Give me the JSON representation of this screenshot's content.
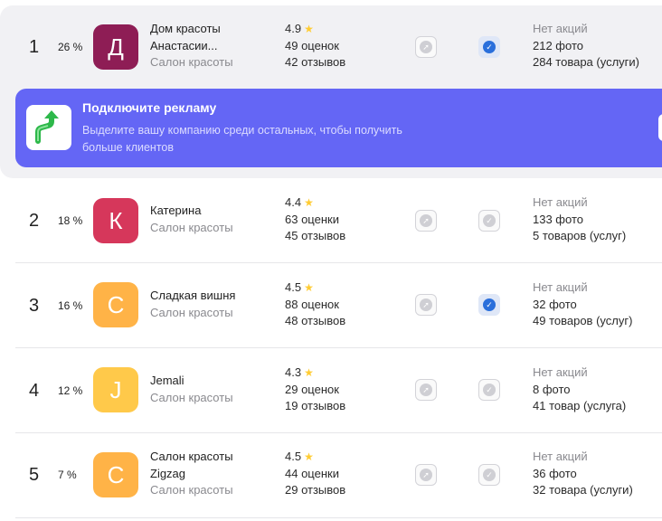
{
  "rows": [
    {
      "rank": "1",
      "share": "26 %",
      "avatar_letter": "Д",
      "avatar_color": "#8e1d55",
      "name_line1": "Дом красоты",
      "name_line2": "Анастасии...",
      "subtype": "Салон красоты",
      "rating": "4.9",
      "ratings_count": "49 оценок",
      "reviews_count": "42 отзывов",
      "verified": true,
      "promos": "Нет акций",
      "photos": "212 фото",
      "goods": "284 товара (услуги)"
    },
    {
      "rank": "2",
      "share": "18 %",
      "avatar_letter": "К",
      "avatar_color": "#d6375b",
      "name_line1": "Катерина",
      "name_line2": "",
      "subtype": "Салон красоты",
      "rating": "4.4",
      "ratings_count": "63 оценки",
      "reviews_count": "45 отзывов",
      "verified": false,
      "promos": "Нет акций",
      "photos": "133 фото",
      "goods": "5 товаров (услуг)"
    },
    {
      "rank": "3",
      "share": "16 %",
      "avatar_letter": "С",
      "avatar_color": "#ffb347",
      "name_line1": "Сладкая вишня",
      "name_line2": "",
      "subtype": "Салон красоты",
      "rating": "4.5",
      "ratings_count": "88 оценок",
      "reviews_count": "48 отзывов",
      "verified": true,
      "promos": "Нет акций",
      "photos": "32 фото",
      "goods": "49 товаров (услуг)"
    },
    {
      "rank": "4",
      "share": "12 %",
      "avatar_letter": "J",
      "avatar_color": "#ffc94a",
      "name_line1": "Jemali",
      "name_line2": "",
      "subtype": "Салон красоты",
      "rating": "4.3",
      "ratings_count": "29 оценок",
      "reviews_count": "19 отзывов",
      "verified": false,
      "promos": "Нет акций",
      "photos": "8 фото",
      "goods": "41 товар (услуга)"
    },
    {
      "rank": "5",
      "share": "7 %",
      "avatar_letter": "С",
      "avatar_color": "#ffb347",
      "name_line1": "Салон красоты",
      "name_line2": "Zigzag",
      "subtype": "Салон красоты",
      "rating": "4.5",
      "ratings_count": "44 оценки",
      "reviews_count": "29 отзывов",
      "verified": false,
      "promos": "Нет акций",
      "photos": "36 фото",
      "goods": "32 товара (услуги)"
    }
  ],
  "ad_banner": {
    "title": "Подключите рекламу",
    "text": "Выделите вашу компанию среди остальных, чтобы получить больше клиентов",
    "icon": "growth-arrow-icon",
    "color": "#6466f5"
  },
  "icons": {
    "compass": "compass-icon",
    "check": "check-circle-icon",
    "star": "star-icon"
  },
  "colors": {
    "checked_blue": "#2a6fdb",
    "star_yellow": "#ffcc33"
  }
}
